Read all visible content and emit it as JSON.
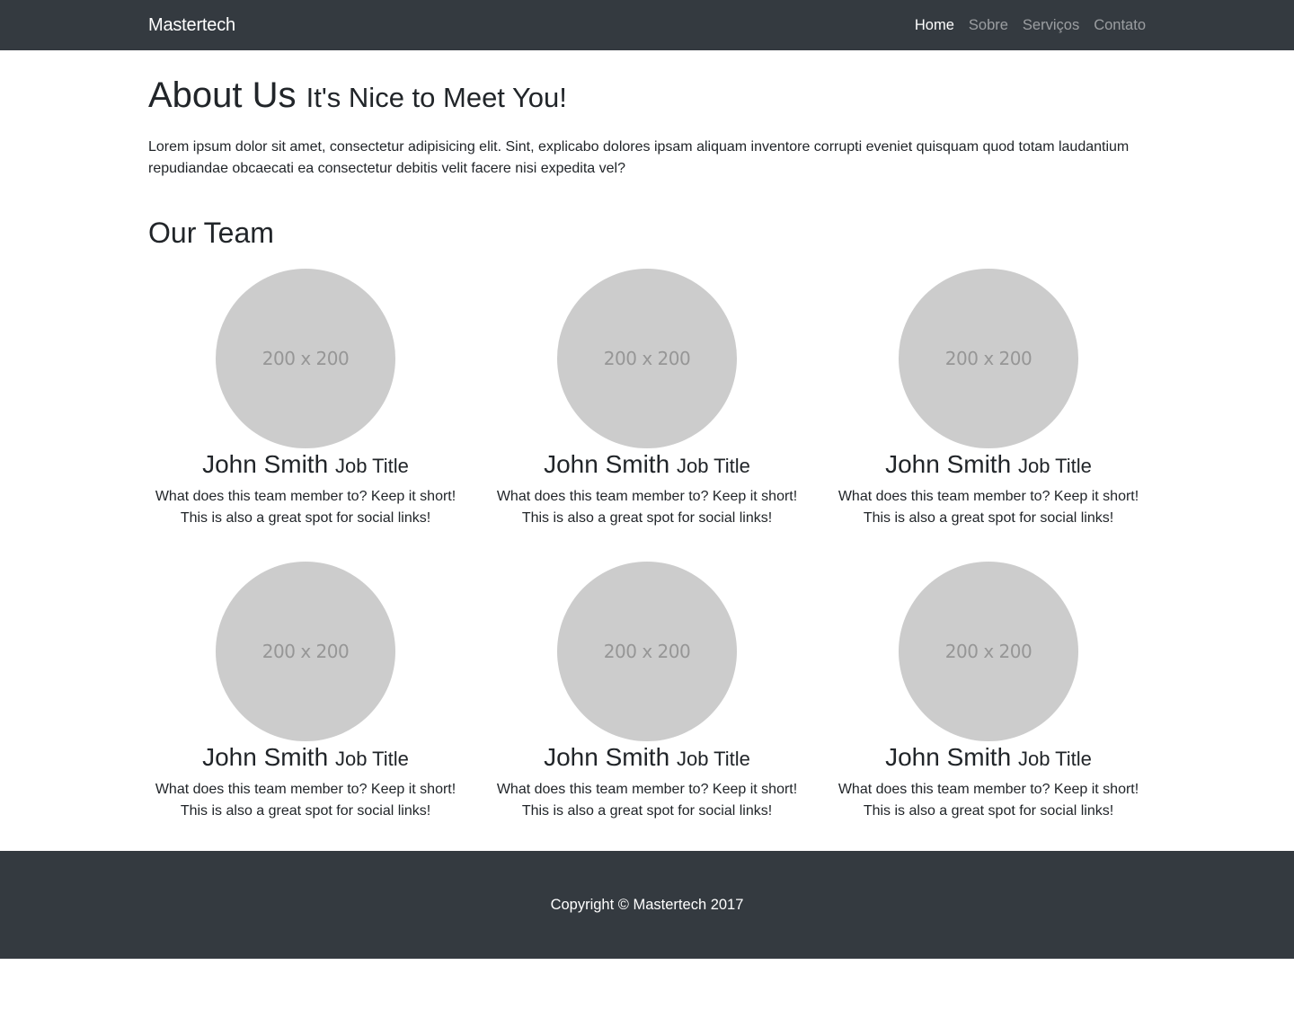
{
  "navbar": {
    "brand": "Mastertech",
    "links": [
      {
        "label": "Home",
        "active": true
      },
      {
        "label": "Sobre",
        "active": false
      },
      {
        "label": "Serviços",
        "active": false
      },
      {
        "label": "Contato",
        "active": false
      }
    ]
  },
  "about": {
    "title": "About Us",
    "subtitle": "It's Nice to Meet You!",
    "text": "Lorem ipsum dolor sit amet, consectetur adipisicing elit. Sint, explicabo dolores ipsam aliquam inventore corrupti eveniet quisquam quod totam laudantium repudiandae obcaecati ea consectetur debitis velit facere nisi expedita vel?"
  },
  "team": {
    "title": "Our Team",
    "members": [
      {
        "avatar": "200 x 200",
        "name": "John Smith",
        "job": "Job Title",
        "desc": "What does this team member to? Keep it short! This is also a great spot for social links!"
      },
      {
        "avatar": "200 x 200",
        "name": "John Smith",
        "job": "Job Title",
        "desc": "What does this team member to? Keep it short! This is also a great spot for social links!"
      },
      {
        "avatar": "200 x 200",
        "name": "John Smith",
        "job": "Job Title",
        "desc": "What does this team member to? Keep it short! This is also a great spot for social links!"
      },
      {
        "avatar": "200 x 200",
        "name": "John Smith",
        "job": "Job Title",
        "desc": "What does this team member to? Keep it short! This is also a great spot for social links!"
      },
      {
        "avatar": "200 x 200",
        "name": "John Smith",
        "job": "Job Title",
        "desc": "What does this team member to? Keep it short! This is also a great spot for social links!"
      },
      {
        "avatar": "200 x 200",
        "name": "John Smith",
        "job": "Job Title",
        "desc": "What does this team member to? Keep it short! This is also a great spot for social links!"
      }
    ]
  },
  "footer": {
    "copyright": "Copyright © Mastertech 2017"
  },
  "colors": {
    "navbar_bg": "#343a40",
    "avatar_bg": "#cccccc",
    "text": "#212529"
  }
}
